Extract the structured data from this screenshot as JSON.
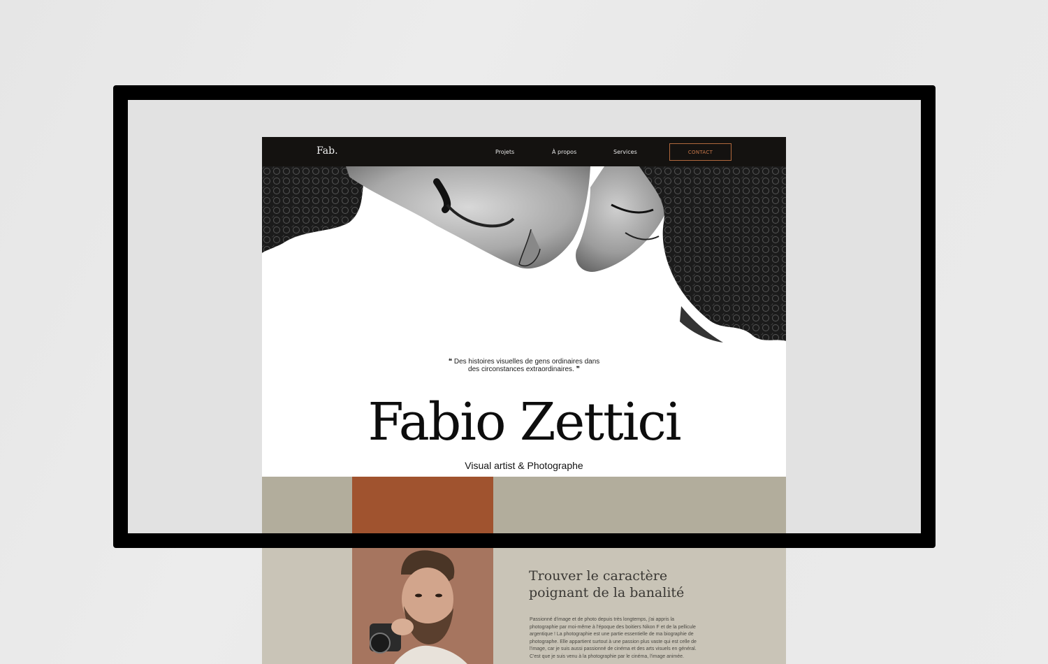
{
  "nav": {
    "logo": "Fab.",
    "links": [
      "Projets",
      "À propos",
      "Services"
    ],
    "contact": "CONTACT"
  },
  "hero": {
    "quote_line1": "❝ Des histoires visuelles de gens ordinaires dans",
    "quote_line2": "des circonstances extraordinaires. ❞",
    "name": "Fabio Zettici",
    "subtitle": "Visual artist & Photographe"
  },
  "about": {
    "title_line1": "Trouver le caractère",
    "title_line2": "poignant de la banalité",
    "text": "Passionné d'image et de photo depuis très longtemps, j'ai appris la photographie par moi-même à l'époque des boitiers Nikon F et de la pellicule argentique ! La photographie est une partie essentielle de ma biographie de photographe. Elle appartient surtout à une passion plus vaste qui est celle de l'image, car je suis aussi passionné de cinéma et des arts visuels en général. C'est que je suis venu à la photographie par le cinéma, l'image animée."
  },
  "colors": {
    "nav_bg": "#141210",
    "contact_accent": "#c9784a",
    "about_bg": "#c9c4b7",
    "frame": "#000000"
  }
}
